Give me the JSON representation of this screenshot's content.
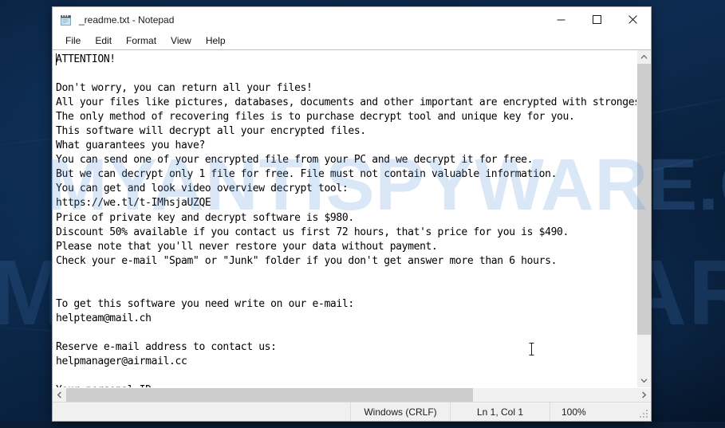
{
  "window": {
    "title": "_readme.txt - Notepad",
    "icon": "notepad-icon",
    "controls": {
      "minimize": "—",
      "maximize": "☐",
      "close": "✕"
    }
  },
  "menubar": {
    "items": [
      {
        "label": "File"
      },
      {
        "label": "Edit"
      },
      {
        "label": "Format"
      },
      {
        "label": "View"
      },
      {
        "label": "Help"
      }
    ]
  },
  "document": {
    "filename": "_readme.txt",
    "lines": [
      "ATTENTION!",
      "",
      "Don't worry, you can return all your files!",
      "All your files like pictures, databases, documents and other important are encrypted with strongest encryption and unique key.",
      "The only method of recovering files is to purchase decrypt tool and unique key for you.",
      "This software will decrypt all your encrypted files.",
      "What guarantees you have?",
      "You can send one of your encrypted file from your PC and we decrypt it for free.",
      "But we can decrypt only 1 file for free. File must not contain valuable information.",
      "You can get and look video overview decrypt tool:",
      "https://we.tl/t-IMhsjaUZQE",
      "Price of private key and decrypt software is $980.",
      "Discount 50% available if you contact us first 72 hours, that's price for you is $490.",
      "Please note that you'll never restore your data without payment.",
      "Check your e-mail \"Spam\" or \"Junk\" folder if you don't get answer more than 6 hours.",
      "",
      "",
      "To get this software you need write on our e-mail:",
      "helpteam@mail.ch",
      "",
      "Reserve e-mail address to contact us:",
      "helpmanager@airmail.cc",
      "",
      "Your personal ID:"
    ],
    "price_full": "$980",
    "price_discounted": "$490",
    "discount_percent": "50%",
    "discount_window_hours": "72",
    "response_time_hours": "6",
    "download_url": "https://we.tl/t-IMhsjaUZQE",
    "email_primary": "helpteam@mail.ch",
    "email_reserve": "helpmanager@airmail.cc"
  },
  "statusbar": {
    "line_ending": "Windows (CRLF)",
    "caret_position": "Ln 1, Col 1",
    "zoom": "100%"
  },
  "scrollbars": {
    "vertical_up": "⌃",
    "vertical_down": "⌄",
    "horizontal_left": "‹",
    "horizontal_right": "›"
  },
  "desktop": {
    "watermark": "MYANTISPYWARE.COM",
    "background_color": "#0a2444"
  },
  "colors": {
    "window_background": "#ffffff",
    "titlebar_background": "#ffffff",
    "statusbar_background": "#f0f0f0",
    "scrollbar_thumb": "#cdcdcd",
    "text_color": "#000000",
    "watermark_color": "#5692dc"
  }
}
